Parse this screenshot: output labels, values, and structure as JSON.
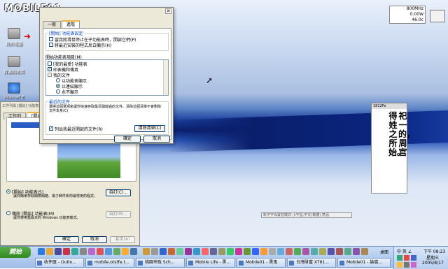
{
  "desktop": {
    "logo": "MOBILE01",
    "sysinfo": [
      "800MHz",
      "0.00W",
      "46.0c"
    ],
    "icons": [
      {
        "label": "我的電腦"
      },
      {
        "label": "資源回收筒"
      },
      {
        "label": "Internet E"
      }
    ]
  },
  "dialog": {
    "tabs": [
      "一般",
      "進階"
    ],
    "group1": {
      "title": "[開始] 功能表設定",
      "options": [
        {
          "label": "當我將滑鼠停止在子功能表時，開啟它們(P)",
          "checked": false
        },
        {
          "label": "將最近安裝的程式反白顯示(H)",
          "checked": false
        }
      ]
    },
    "group2": {
      "title": "開始功能表項目(M)",
      "items": [
        {
          "label": "[我的最愛] 功能表",
          "kind": "check",
          "checked": false
        },
        {
          "label": "印表機和傳真",
          "kind": "check",
          "checked": true
        },
        {
          "label": "我的文件",
          "kind": "check",
          "checked": false
        },
        {
          "label": "以功能表顯示",
          "kind": "radio",
          "checked": false
        },
        {
          "label": "以連結顯示",
          "kind": "radio",
          "checked": true
        },
        {
          "label": "永不顯示",
          "kind": "radio",
          "checked": false
        }
      ]
    },
    "group3": {
      "title": "最近的文件",
      "desc": "選擇這個選項來讓你快速存取最近開啟過的文件。清除這個清單不會刪除文件本身(C)",
      "checkbox": "列出我最近開啟的文件(R)",
      "clear_button": "清除清單(C)"
    },
    "ok": "確定",
    "cancel": "取消"
  },
  "back_window": {
    "tabs": [
      "工作列",
      "[開始]"
    ],
    "tab_header": "工作列與 [開始] 功能表內容",
    "radio1": "[開始] 功能表(S)",
    "radio1_desc": "讓你簡單存取網際網路、電子郵件和你最常用的程式。",
    "radio2": "傳統 [開始] 功能表(M)",
    "radio2_desc": "讓你使用舊版本的 Windows 功能表樣式。",
    "customize1": "自訂(C)...",
    "customize2": "自訂(R)...",
    "ok": "確定",
    "cancel": "取消",
    "apply": "套用(A)"
  },
  "vertical_text": {
    "title": "1812Fe",
    "columns": [
      "得姓之所始。",
      "祀一的，周官"
    ]
  },
  "input_bar": "新字字母置音模式-小字型,中文(繁體),意涵",
  "tag": "#1658",
  "taskbar": {
    "start": "開始",
    "buttons": [
      "收件匣 - Outlo...",
      "mobile.otstfe.t...",
      "桃園市政 Sch...",
      "Mobile Life - 黑...",
      "Mobile01 - 黑鬼",
      "台灣財富 XT61...",
      "Mobile01 - 論壇..."
    ],
    "tray": {
      "lang": "中 英 ∠",
      "time": "下午 08:23",
      "day": "星期三",
      "date": "2005/8/17",
      "label": "桌面"
    }
  }
}
